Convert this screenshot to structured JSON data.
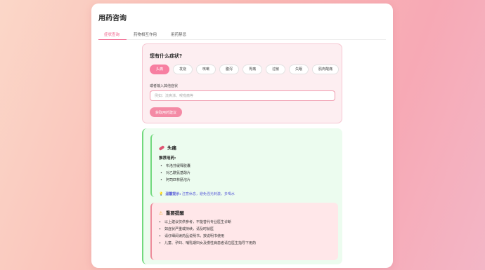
{
  "app": {
    "title": "用药咨询"
  },
  "tabs": [
    {
      "label": "症状查询",
      "active": true
    },
    {
      "label": "药物相互作用",
      "active": false
    },
    {
      "label": "用药禁忌",
      "active": false
    }
  ],
  "symptom_section": {
    "title": "您有什么症状?",
    "chips": [
      {
        "label": "头痛",
        "selected": true
      },
      {
        "label": "发烧",
        "selected": false
      },
      {
        "label": "咳嗽",
        "selected": false
      },
      {
        "label": "腹泻",
        "selected": false
      },
      {
        "label": "胃痛",
        "selected": false
      },
      {
        "label": "过敏",
        "selected": false
      },
      {
        "label": "失眠",
        "selected": false
      },
      {
        "label": "肌肉酸痛",
        "selected": false
      }
    ],
    "input_label": "或者输入其他症状",
    "input_placeholder": "例如：流鼻涕、喉咙痛等",
    "input_value": "",
    "submit_label": "获取用药建议"
  },
  "recommendation": {
    "icon": "pill-icon",
    "title": "头痛",
    "subtitle": "推荐用药:",
    "medicines": [
      "布洛芬缓释胶囊",
      "对乙酰氨基酚片",
      "阿司匹林肠溶片"
    ],
    "tip_icon": "lightbulb-icon",
    "tip_label": "温馨提示:",
    "tip_text": "注意休息，避免强光刺激，多喝水"
  },
  "warning": {
    "icon": "warning-icon",
    "title": "重要提醒",
    "items": [
      "以上建议仅供参考，不能替代专业医生诊断",
      "如症状严重或持续，请及时就医",
      "请仔细阅读药品说明书，按说明书使用",
      "儿童、孕妇、哺乳期妇女及慢性病患者请在医生指导下用药"
    ]
  },
  "colors": {
    "accent": "#f0608a",
    "chip_selected": "#f77fa1",
    "success_border": "#72d97e",
    "tip_text": "#5b5fd8",
    "warning_bg": "#ffe7e9"
  }
}
